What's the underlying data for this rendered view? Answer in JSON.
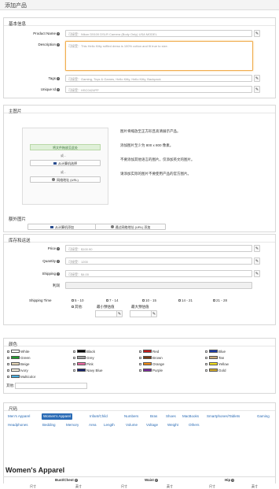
{
  "page_title": "添加产品",
  "basic": {
    "heading": "基本信息",
    "product_name_label": "Product Name",
    "product_name_placeholder": "可接受：Nikon D5100 DSLR Camera (Body Only) USA MODEL",
    "description_label": "Description",
    "description_placeholder": "可接受：This Hello Kitty ruffled dress is 100% cotton and fit true to size.",
    "tags_label": "Tags",
    "tags_placeholder": "可接受：Gaming, Toys & Games, Hello Kitty, Hello Kitty, Backpack",
    "unique_id_label": "Unique Id",
    "unique_id_placeholder": "可接受：HSC0424PP"
  },
  "images": {
    "heading": "主图片",
    "drop_label": "将文件拖放至此处",
    "or1": "或...",
    "from_computer": "从计算机选择",
    "or2": "或...",
    "from_url": "网络地址 (URL)",
    "tips": [
      "图片将缩放至正方形且高清展示产品。",
      "添加图片至少为 800 x 800 像素。",
      "不要添加其他语言的图片，仅添加英文的图片。",
      "请添加实际的图片不要使用产品的官方图片。"
    ],
    "extra_heading": "额外图片",
    "extra_from_computer": "从计算机添加",
    "extra_from_url": "通过网络地址 (URL) 添加"
  },
  "inventory": {
    "heading": "库存和运送",
    "price_label": "Price",
    "price_placeholder": "可接受：$100.90",
    "quantity_label": "Quantity",
    "quantity_placeholder": "可接受：1200",
    "shipping_label": "Shipping",
    "shipping_placeholder": "可接受：$4.00",
    "profit_label": "利润",
    "shipping_time_label": "Shipping Time",
    "options": [
      "5 - 10",
      "7 - 14",
      "10 - 15",
      "14 - 21",
      "21 - 28"
    ],
    "other_label": "其他:",
    "min_days_label": "最小预估值",
    "max_days_label": "最大预估值"
  },
  "colors": {
    "heading": "颜色",
    "items": [
      {
        "name": "White",
        "hex": "#ffffff"
      },
      {
        "name": "Black",
        "hex": "#000000"
      },
      {
        "name": "Red",
        "hex": "#c81a1a"
      },
      {
        "name": "Blue",
        "hex": "#1b3aa8"
      },
      {
        "name": "Green",
        "hex": "#1f9c2b"
      },
      {
        "name": "Grey",
        "hex": "#a0a0a0"
      },
      {
        "name": "Brown",
        "hex": "#7a3b10"
      },
      {
        "name": "Tan",
        "hex": "#c9a877"
      },
      {
        "name": "Beige",
        "hex": "#e8d9b8"
      },
      {
        "name": "Pink",
        "hex": "#f06ba5"
      },
      {
        "name": "Orange",
        "hex": "#f08a13"
      },
      {
        "name": "Yellow",
        "hex": "#f4e01e"
      },
      {
        "name": "Ivory",
        "hex": "#fbf6e4"
      },
      {
        "name": "Navy Blue",
        "hex": "#16236b"
      },
      {
        "name": "Purple",
        "hex": "#7a2a9a"
      },
      {
        "name": "Gold",
        "hex": "#d1a92b"
      },
      {
        "name": "Multicolor",
        "hex": "#4bb0e0"
      }
    ],
    "other_label": "其他:"
  },
  "sizes": {
    "heading": "尺码",
    "tabs_row1": [
      "Men's Apparel",
      "Women's Apparel",
      "Infant/Child",
      "Numbers",
      "Bras",
      "Shoes",
      "MacBooks",
      "Smartphones/Tablets",
      "Gaming"
    ],
    "tabs_row2": [
      "Headphones",
      "Bedding",
      "Memory",
      "Area",
      "Length",
      "Volume",
      "Voltage",
      "Weight",
      "Others"
    ],
    "section_title": "Women's Apparel",
    "col_bust": "Bust/Chest",
    "col_waist": "Waist",
    "col_hip": "Hip",
    "sub_size": "尺寸",
    "sub_inches": "英寸"
  }
}
